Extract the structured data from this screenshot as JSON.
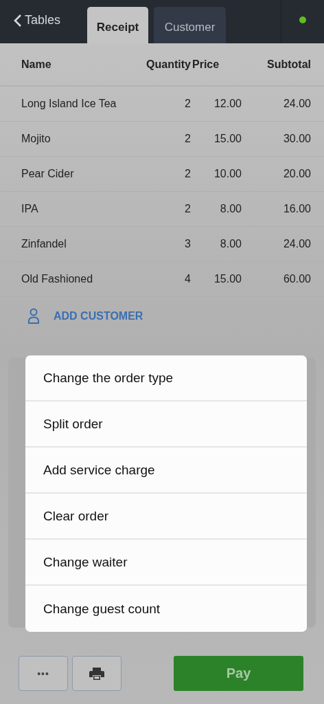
{
  "nav": {
    "back_label": "Tables"
  },
  "tabs": [
    {
      "label": "Receipt",
      "selected": true
    },
    {
      "label": "Customer",
      "selected": false
    }
  ],
  "table": {
    "columns": [
      "Name",
      "Quantity",
      "Price",
      "Subtotal"
    ],
    "rows": [
      [
        "Long Island Ice Tea",
        "2",
        "12.00",
        "24.00"
      ],
      [
        "Mojito",
        "2",
        "15.00",
        "30.00"
      ],
      [
        "Pear Cider",
        "2",
        "10.00",
        "20.00"
      ],
      [
        "IPA",
        "2",
        "8.00",
        "16.00"
      ],
      [
        "Zinfandel",
        "3",
        "8.00",
        "24.00"
      ],
      [
        "Old Fashioned",
        "4",
        "15.00",
        "60.00"
      ]
    ]
  },
  "add_customer": "ADD CUSTOMER",
  "menu": [
    "Change the order type",
    "Split order",
    "Add service charge",
    "Clear order",
    "Change waiter",
    "Change guest count"
  ],
  "actions": {
    "more": "•••",
    "pay": "Pay"
  }
}
